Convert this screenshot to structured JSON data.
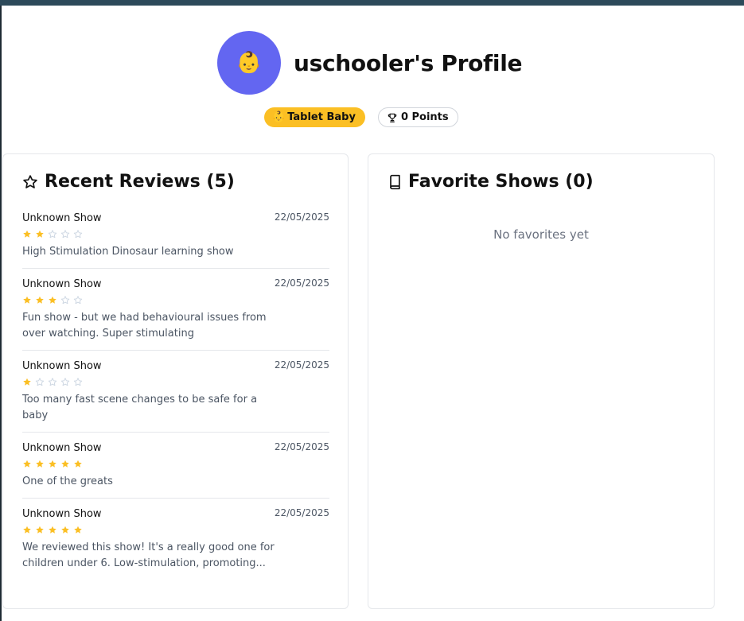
{
  "profile": {
    "avatar_emoji": "👶",
    "title": "uschooler's Profile",
    "rank_emoji": "👶",
    "rank_label": "Tablet Baby",
    "points_label": "0 Points"
  },
  "colors": {
    "avatar_bg": "#6366f1",
    "rank_badge_bg": "#fbbf24",
    "star_filled": "#fbbf24",
    "star_empty": "#cbd5e1",
    "top_bar": "#2d4a5a"
  },
  "icons": {
    "reviews_header": "star-outline-icon",
    "favorites_header": "book-icon",
    "points_badge": "trophy-icon"
  },
  "reviews": {
    "title": "Recent Reviews (5)",
    "items": [
      {
        "show": "Unknown Show",
        "date": "22/05/2025",
        "rating": 2,
        "text": "High Stimulation Dinosaur learning show"
      },
      {
        "show": "Unknown Show",
        "date": "22/05/2025",
        "rating": 3,
        "text": "Fun show - but we had behavioural issues from over watching. Super stimulating"
      },
      {
        "show": "Unknown Show",
        "date": "22/05/2025",
        "rating": 1,
        "text": "Too many fast scene changes to be safe for a baby"
      },
      {
        "show": "Unknown Show",
        "date": "22/05/2025",
        "rating": 5,
        "text": "One of the greats"
      },
      {
        "show": "Unknown Show",
        "date": "22/05/2025",
        "rating": 5,
        "text": "We reviewed this show! It's a really good one for children under 6. Low-stimulation, promoting..."
      }
    ]
  },
  "favorites": {
    "title": "Favorite Shows (0)",
    "empty_message": "No favorites yet"
  }
}
